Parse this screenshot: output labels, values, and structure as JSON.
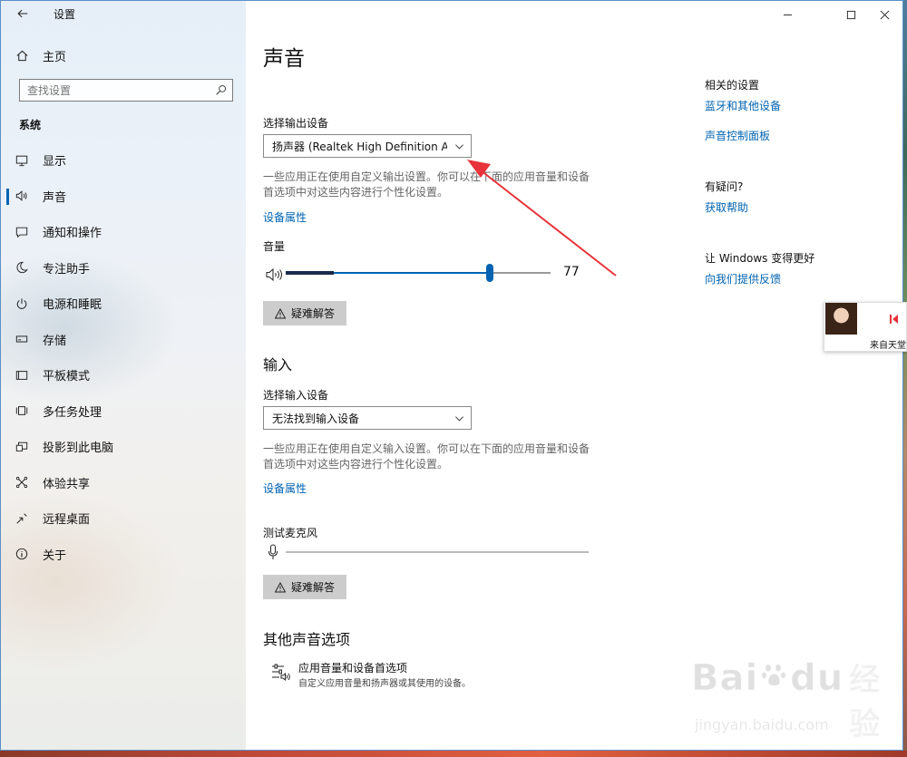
{
  "window": {
    "title": "设置"
  },
  "sidebar": {
    "home_label": "主页",
    "search_placeholder": "查找设置",
    "section_title": "系统",
    "items": [
      {
        "label": "显示",
        "icon": "monitor-icon"
      },
      {
        "label": "声音",
        "icon": "speaker-icon",
        "active": true
      },
      {
        "label": "通知和操作",
        "icon": "notification-icon"
      },
      {
        "label": "专注助手",
        "icon": "moon-icon"
      },
      {
        "label": "电源和睡眠",
        "icon": "power-icon"
      },
      {
        "label": "存储",
        "icon": "storage-icon"
      },
      {
        "label": "平板模式",
        "icon": "tablet-icon"
      },
      {
        "label": "多任务处理",
        "icon": "multitask-icon"
      },
      {
        "label": "投影到此电脑",
        "icon": "project-icon"
      },
      {
        "label": "体验共享",
        "icon": "share-icon"
      },
      {
        "label": "远程桌面",
        "icon": "remote-icon"
      },
      {
        "label": "关于",
        "icon": "info-icon"
      }
    ]
  },
  "main": {
    "title": "声音",
    "output": {
      "label": "选择输出设备",
      "device": "扬声器 (Realtek High Definition A...",
      "desc": "一些应用正在使用自定义输出设置。你可以在下面的应用音量和设备首选项中对这些内容进行个性化设置。",
      "properties_link": "设备属性",
      "volume_label": "音量",
      "volume_value": 77,
      "volume_peak": 0.18,
      "troubleshoot": "疑难解答"
    },
    "input": {
      "heading": "输入",
      "label": "选择输入设备",
      "device": "无法找到输入设备",
      "desc": "一些应用正在使用自定义输入设置。你可以在下面的应用音量和设备首选项中对这些内容进行个性化设置。",
      "properties_link": "设备属性",
      "mic_label": "测试麦克风",
      "troubleshoot": "疑难解答"
    },
    "other": {
      "heading": "其他声音选项",
      "app_volume_title": "应用音量和设备首选项",
      "app_volume_desc": "自定义应用音量和扬声器或其使用的设备。"
    }
  },
  "related": {
    "heading": "相关的设置",
    "links": [
      "蓝牙和其他设备",
      "声音控制面板"
    ],
    "question_heading": "有疑问?",
    "help_link": "获取帮助",
    "improve_heading": "让 Windows 变得更好",
    "feedback_link": "向我们提供反馈"
  },
  "overlay": {
    "float_text": "来自天堂",
    "watermark_logo_left": "Bai",
    "watermark_logo_right": "du",
    "watermark_brand": "经验",
    "watermark_url": "jingyan.baidu.com"
  },
  "colors": {
    "accent": "#0063b1",
    "arrow": "#e8333a"
  }
}
